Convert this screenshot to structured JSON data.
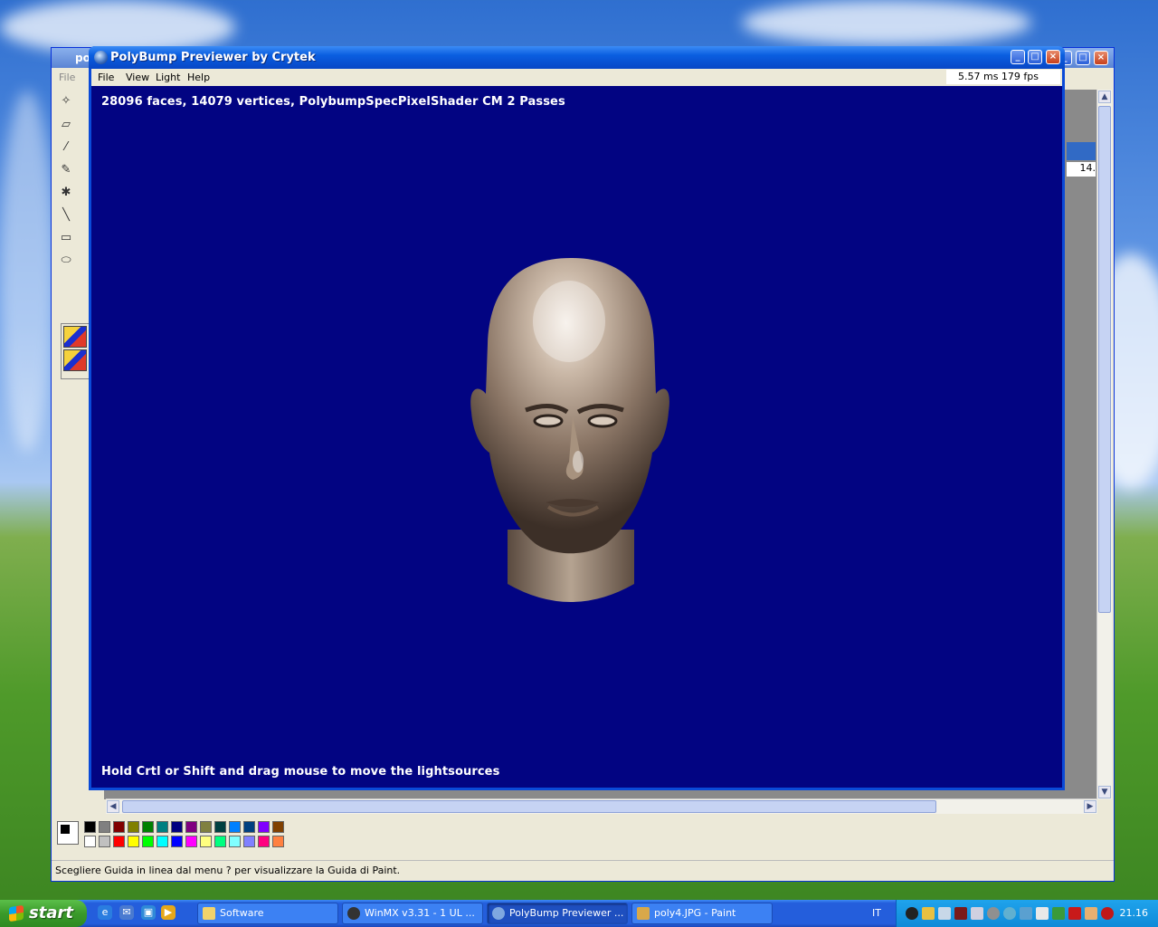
{
  "paint_window": {
    "title": "poly4.JPG - Paint",
    "title_visible": "pol",
    "menu": {
      "file": "File"
    },
    "status_text": "Scegliere Guida in linea dal menu ? per visualizzare la Guida di Paint.",
    "field_value": "14."
  },
  "polybump_window": {
    "title": "PolyBump Previewer by Crytek",
    "menu": [
      "File",
      "View",
      "Light",
      "Help"
    ],
    "fps_readout": "5.57 ms 179 fps",
    "info_line": "28096 faces, 14079 vertices, PolybumpSpecPixelShader CM 2 Passes",
    "hint_line": "Hold Crtl or Shift and drag mouse to move the lightsources",
    "viewport_color": "#020482"
  },
  "taskbar": {
    "start_label": "start",
    "tasks": [
      {
        "label": "Software",
        "icon": "folder-icon"
      },
      {
        "label": "WinMX v3.31  - 1 UL ...",
        "icon": "winmx-icon"
      },
      {
        "label": "PolyBump Previewer ...",
        "icon": "polybump-icon",
        "active": true
      },
      {
        "label": "poly4.JPG - Paint",
        "icon": "paint-icon"
      }
    ],
    "language": "IT",
    "clock": "21.16"
  },
  "palette_top": [
    "#000000",
    "#808080",
    "#800000",
    "#808000",
    "#008000",
    "#008080",
    "#000080",
    "#800080",
    "#808040",
    "#004040",
    "#0080ff",
    "#004080",
    "#8000ff",
    "#804000"
  ],
  "palette_bottom": [
    "#ffffff",
    "#c0c0c0",
    "#ff0000",
    "#ffff00",
    "#00ff00",
    "#00ffff",
    "#0000ff",
    "#ff00ff",
    "#ffff80",
    "#00ff80",
    "#80ffff",
    "#8080ff",
    "#ff0080",
    "#ff8040"
  ]
}
